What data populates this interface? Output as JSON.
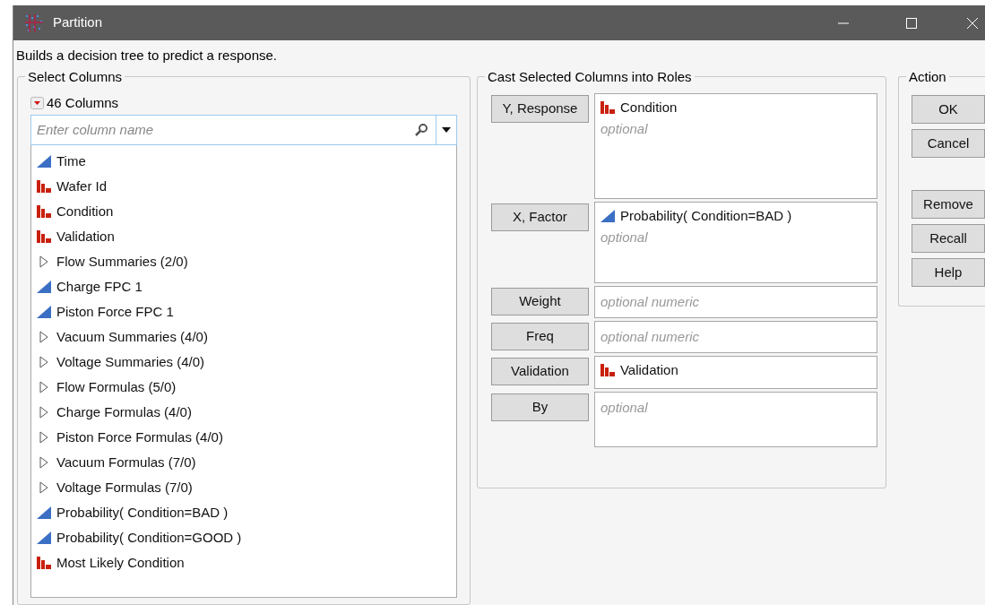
{
  "window": {
    "title": "Partition"
  },
  "description": "Builds a decision tree to predict a response.",
  "select_columns": {
    "title": "Select Columns",
    "count": "46 Columns",
    "search": {
      "placeholder": "Enter column name"
    },
    "columns": [
      {
        "kind": "continuous",
        "name": "Time"
      },
      {
        "kind": "nominal",
        "name": "Wafer Id"
      },
      {
        "kind": "nominal",
        "name": "Condition"
      },
      {
        "kind": "nominal",
        "name": "Validation"
      },
      {
        "kind": "group",
        "name": "Flow Summaries (2/0)",
        "expanded": false
      },
      {
        "kind": "continuous",
        "name": "Charge FPC 1"
      },
      {
        "kind": "continuous",
        "name": "Piston Force FPC 1"
      },
      {
        "kind": "group",
        "name": "Vacuum Summaries (4/0)",
        "expanded": false
      },
      {
        "kind": "group",
        "name": "Voltage Summaries (4/0)",
        "expanded": false
      },
      {
        "kind": "group",
        "name": "Flow Formulas (5/0)",
        "expanded": false
      },
      {
        "kind": "group",
        "name": "Charge Formulas (4/0)",
        "expanded": false
      },
      {
        "kind": "group",
        "name": "Piston Force Formulas (4/0)",
        "expanded": false
      },
      {
        "kind": "group",
        "name": "Vacuum Formulas (7/0)",
        "expanded": false
      },
      {
        "kind": "group",
        "name": "Voltage Formulas (7/0)",
        "expanded": false
      },
      {
        "kind": "continuous",
        "name": "Probability( Condition=BAD )"
      },
      {
        "kind": "continuous",
        "name": "Probability( Condition=GOOD )"
      },
      {
        "kind": "nominal",
        "name": "Most Likely Condition"
      }
    ]
  },
  "roles": {
    "title": "Cast Selected Columns into Roles",
    "items": [
      {
        "button": "Y, Response",
        "columns": [
          {
            "kind": "nominal",
            "name": "Condition"
          }
        ],
        "placeholder": "optional"
      },
      {
        "button": "X, Factor",
        "columns": [
          {
            "kind": "continuous",
            "name": "Probability( Condition=BAD )"
          }
        ],
        "placeholder": "optional"
      },
      {
        "button": "Weight",
        "placeholder": "optional numeric"
      },
      {
        "button": "Freq",
        "placeholder": "optional numeric"
      },
      {
        "button": "Validation",
        "columns": [
          {
            "kind": "nominal",
            "name": "Validation"
          }
        ]
      },
      {
        "button": "By",
        "placeholder": "optional"
      }
    ]
  },
  "action": {
    "title": "Action",
    "buttons": [
      "OK",
      "Cancel",
      "Remove",
      "Recall",
      "Help"
    ]
  }
}
